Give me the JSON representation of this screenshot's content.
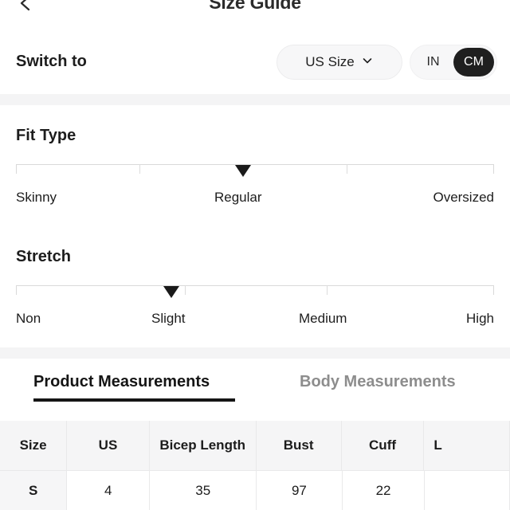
{
  "header": {
    "back_icon": "chevron-left-icon",
    "title": "Size Guide"
  },
  "switch": {
    "label": "Switch to",
    "size_system": {
      "value": "US Size",
      "chevron_icon": "chevron-down-icon"
    },
    "unit_toggle": {
      "options": [
        "IN",
        "CM"
      ],
      "selected": "CM"
    }
  },
  "fit_type": {
    "title": "Fit Type",
    "labels": [
      "Skinny",
      "Regular",
      "Oversized"
    ],
    "selected": "Regular",
    "marker_percent": 47.5,
    "tick_percents": [
      0,
      25.8,
      69.2,
      100
    ]
  },
  "stretch": {
    "title": "Stretch",
    "labels": [
      "Non",
      "Slight",
      "Medium",
      "High"
    ],
    "selected": "Slight",
    "marker_percent": 32.5,
    "tick_percents": [
      0,
      35.3,
      65.0,
      100
    ]
  },
  "tabs": [
    {
      "label": "Product Measurements",
      "active": true
    },
    {
      "label": "Body Measurements",
      "active": false
    }
  ],
  "table": {
    "columns": [
      "Size",
      "US",
      "Bicep Length",
      "Bust",
      "Cuff",
      "L"
    ],
    "rows": [
      [
        "S",
        "4",
        "35",
        "97",
        "22",
        ""
      ]
    ]
  },
  "colors": {
    "accent": "#1f1f1f",
    "text": "#1d1d1d",
    "muted": "#8d8d8d",
    "band": "#f4f4f5",
    "table_header_bg": "#f5f5f6",
    "border": "#e9e9ea"
  }
}
